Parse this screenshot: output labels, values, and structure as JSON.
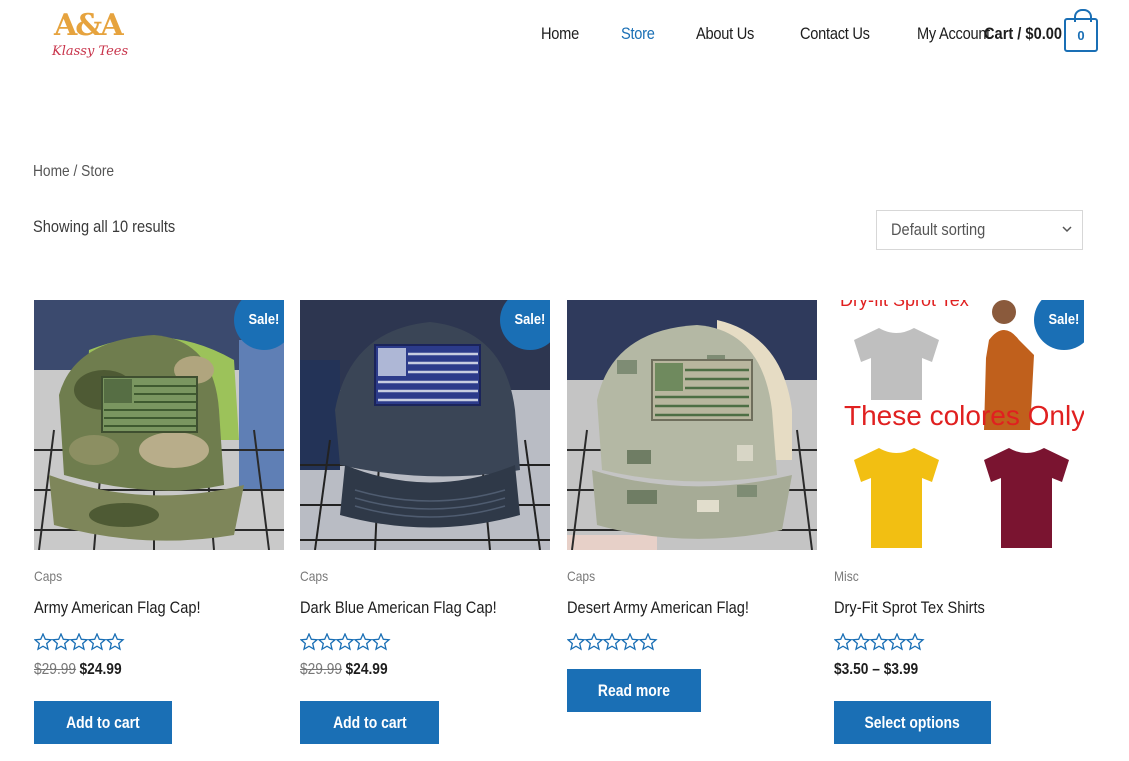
{
  "header": {
    "logo_monogram": "A&A",
    "logo_amp": "&",
    "logo_text": "Klassy Tees",
    "nav": [
      {
        "label": "Home",
        "active": false
      },
      {
        "label": "Store",
        "active": true
      },
      {
        "label": "About Us",
        "active": false
      },
      {
        "label": "Contact Us",
        "active": false
      },
      {
        "label": "My Account",
        "active": false
      }
    ],
    "cart_label": "Cart / $0.00",
    "cart_count": "0"
  },
  "breadcrumb": {
    "home": "Home",
    "separator": " / ",
    "current": "Store"
  },
  "results_count": "Showing all 10 results",
  "sorting": {
    "selected": "Default sorting"
  },
  "colors": {
    "accent": "#1a6fb5"
  },
  "products": [
    {
      "category": "Caps",
      "title": "Army American Flag Cap!",
      "sale_badge": "Sale!",
      "rating": 0,
      "old_price": "$29.99",
      "price": "$24.99",
      "button": "Add to cart"
    },
    {
      "category": "Caps",
      "title": "Dark Blue American Flag Cap!",
      "sale_badge": "Sale!",
      "rating": 0,
      "old_price": "$29.99",
      "price": "$24.99",
      "button": "Add to cart"
    },
    {
      "category": "Caps",
      "title": "Desert Army American Flag!",
      "sale_badge": "",
      "rating": 0,
      "old_price": "",
      "price": "",
      "button": "Read more"
    },
    {
      "category": "Misc",
      "title": "Dry-Fit Sprot Tex Shirts",
      "sale_badge": "Sale!",
      "rating": 0,
      "old_price": "",
      "price": "$3.50 – $3.99",
      "button": "Select options",
      "image_text_top": "Dry-fit Sprot Tex",
      "image_text_mid": "These colores Only"
    }
  ]
}
